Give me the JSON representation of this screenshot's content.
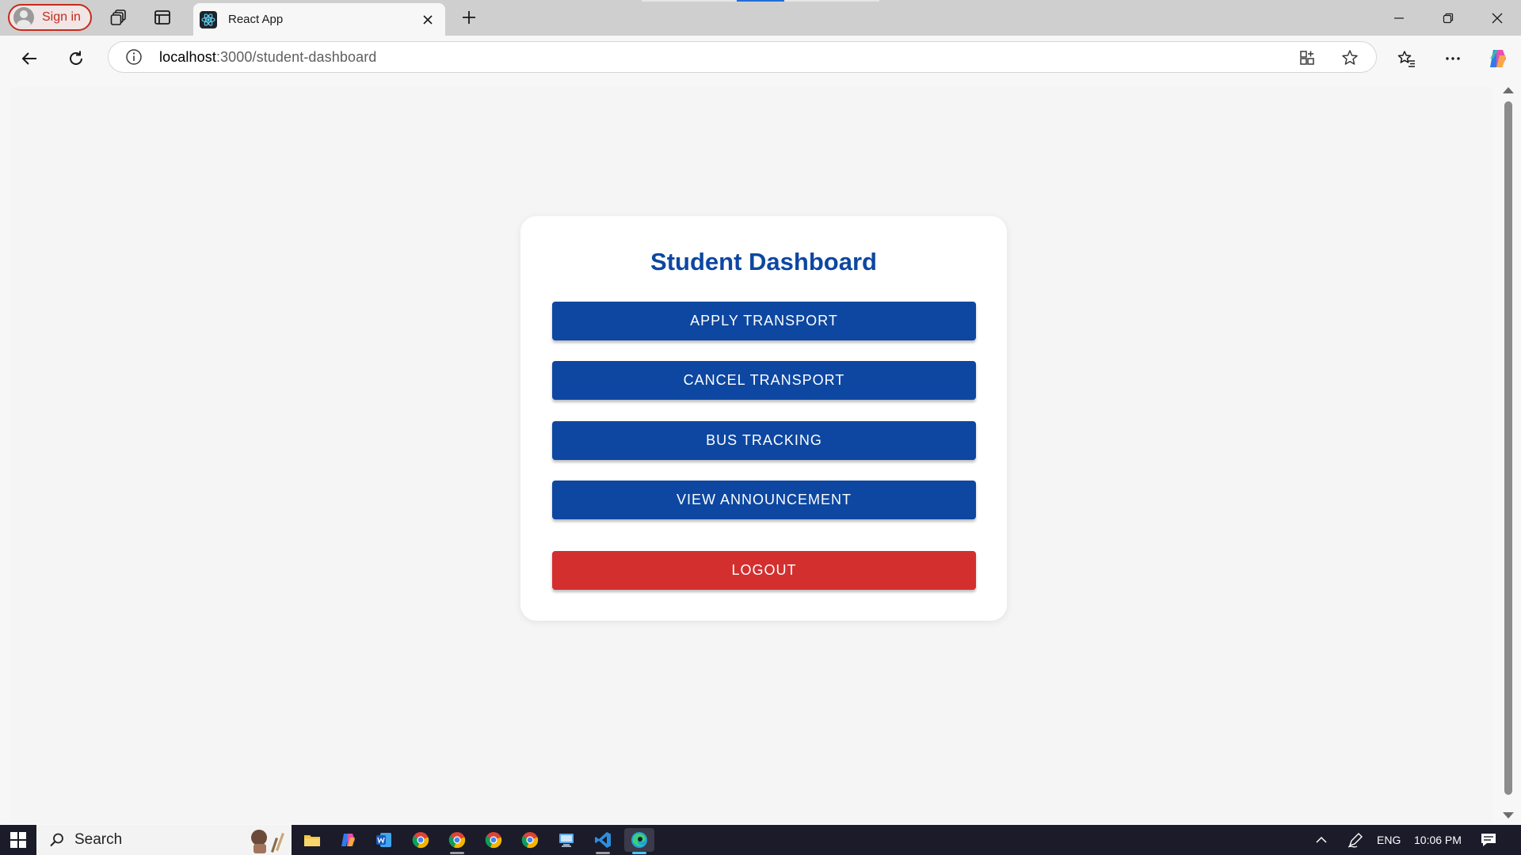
{
  "browser": {
    "profile_label": "Sign in",
    "tab_title": "React App",
    "address": {
      "host": "localhost",
      "rest": ":3000/student-dashboard"
    },
    "icons": [
      "workspaces-icon",
      "vertical-tabs-icon",
      "react-favicon-icon",
      "close-icon",
      "plus-icon",
      "back-icon",
      "refresh-icon",
      "info-icon",
      "app-available-icon",
      "favorite-star-icon",
      "favorites-icon",
      "more-icon",
      "copilot-icon",
      "minimize-icon",
      "restore-icon",
      "window-close-icon"
    ]
  },
  "dashboard": {
    "title": "Student Dashboard",
    "buttons": {
      "apply": "APPLY TRANSPORT",
      "cancel": "CANCEL TRANSPORT",
      "tracking": "BUS TRACKING",
      "announcement": "VIEW ANNOUNCEMENT",
      "logout": "LOGOUT"
    },
    "colors": {
      "primary": "#0d47a1",
      "logout": "#d32f2f",
      "background": "#f5f5f5",
      "card": "#ffffff"
    }
  },
  "taskbar": {
    "search_label": "Search",
    "language": "ENG",
    "time": "10:06 PM",
    "apps": [
      "file-explorer",
      "copilot",
      "word",
      "chrome",
      "chrome",
      "chrome",
      "chrome",
      "remote-desktop",
      "vscode",
      "edge"
    ]
  }
}
